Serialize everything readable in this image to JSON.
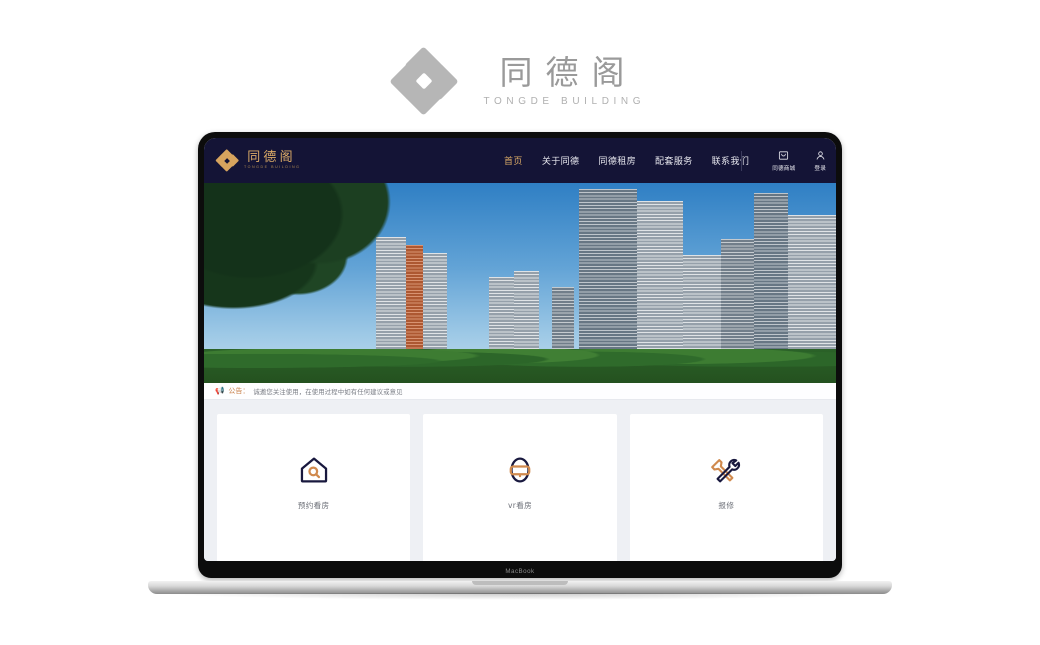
{
  "brand_header": {
    "logo_icon": "four-diamond-logo-icon",
    "name_cn": "同德阁",
    "name_en": "TONGDE BUILDING"
  },
  "laptop": {
    "model_label": "MacBook"
  },
  "site": {
    "navbar": {
      "logo_icon": "four-diamond-logo-icon",
      "logo_cn": "同德阁",
      "logo_en": "TONGDE BUILDING",
      "links": [
        {
          "label": "首页",
          "active": true
        },
        {
          "label": "关于同德",
          "active": false
        },
        {
          "label": "同德租房",
          "active": false
        },
        {
          "label": "配套服务",
          "active": false
        },
        {
          "label": "联系我们",
          "active": false
        }
      ],
      "actions": [
        {
          "label": "同德商城",
          "icon": "shop-icon"
        },
        {
          "label": "登录",
          "icon": "user-icon"
        }
      ]
    },
    "announcement": {
      "icon": "megaphone-icon",
      "keyword": "公告：",
      "text": "诚邀您关注使用，在使用过程中如有任何建议或意见"
    },
    "cards": [
      {
        "label": "预约看房",
        "icon": "house-search-icon"
      },
      {
        "label": "vr看房",
        "icon": "vr-headset-icon"
      },
      {
        "label": "报修",
        "icon": "wrench-screwdriver-icon"
      }
    ]
  },
  "colors": {
    "navy": "#141436",
    "gold": "#dcab67",
    "orange": "#d08a4e",
    "page_bg": "#eef0f4",
    "card_bg": "#ffffff"
  }
}
